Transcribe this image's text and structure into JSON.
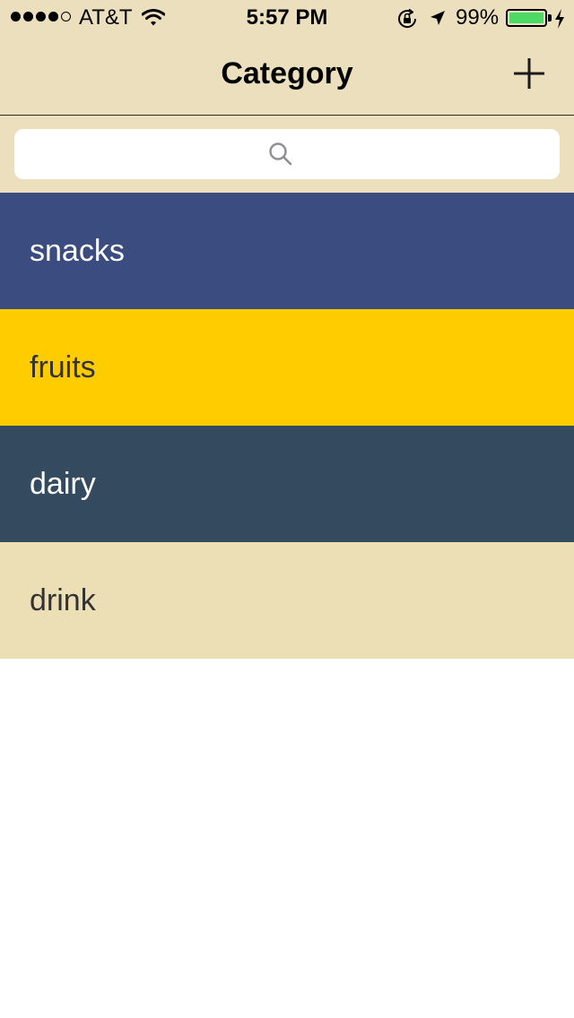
{
  "status_bar": {
    "carrier": "AT&T",
    "time": "5:57 PM",
    "battery_percent": "99%",
    "battery_level": 0.99,
    "signal_bars_filled": 4,
    "signal_bars_total": 5,
    "icons": [
      "wifi-icon",
      "orientation-lock-icon",
      "location-arrow-icon",
      "battery-icon",
      "charging-bolt-icon"
    ]
  },
  "nav": {
    "title": "Category",
    "add_icon": "plus-icon"
  },
  "search": {
    "placeholder": "",
    "value": "",
    "icon": "magnifying-glass-icon"
  },
  "colors": {
    "header_bg": "#ecdfbd",
    "battery_green": "#4cd964"
  },
  "categories": [
    {
      "label": "snacks",
      "bg": "#3a4c80",
      "fg": "#ffffff"
    },
    {
      "label": "fruits",
      "bg": "#ffcc00",
      "fg": "#333333"
    },
    {
      "label": "dairy",
      "bg": "#344a5f",
      "fg": "#ffffff"
    },
    {
      "label": "drink",
      "bg": "#ecdfb5",
      "fg": "#333333"
    }
  ]
}
